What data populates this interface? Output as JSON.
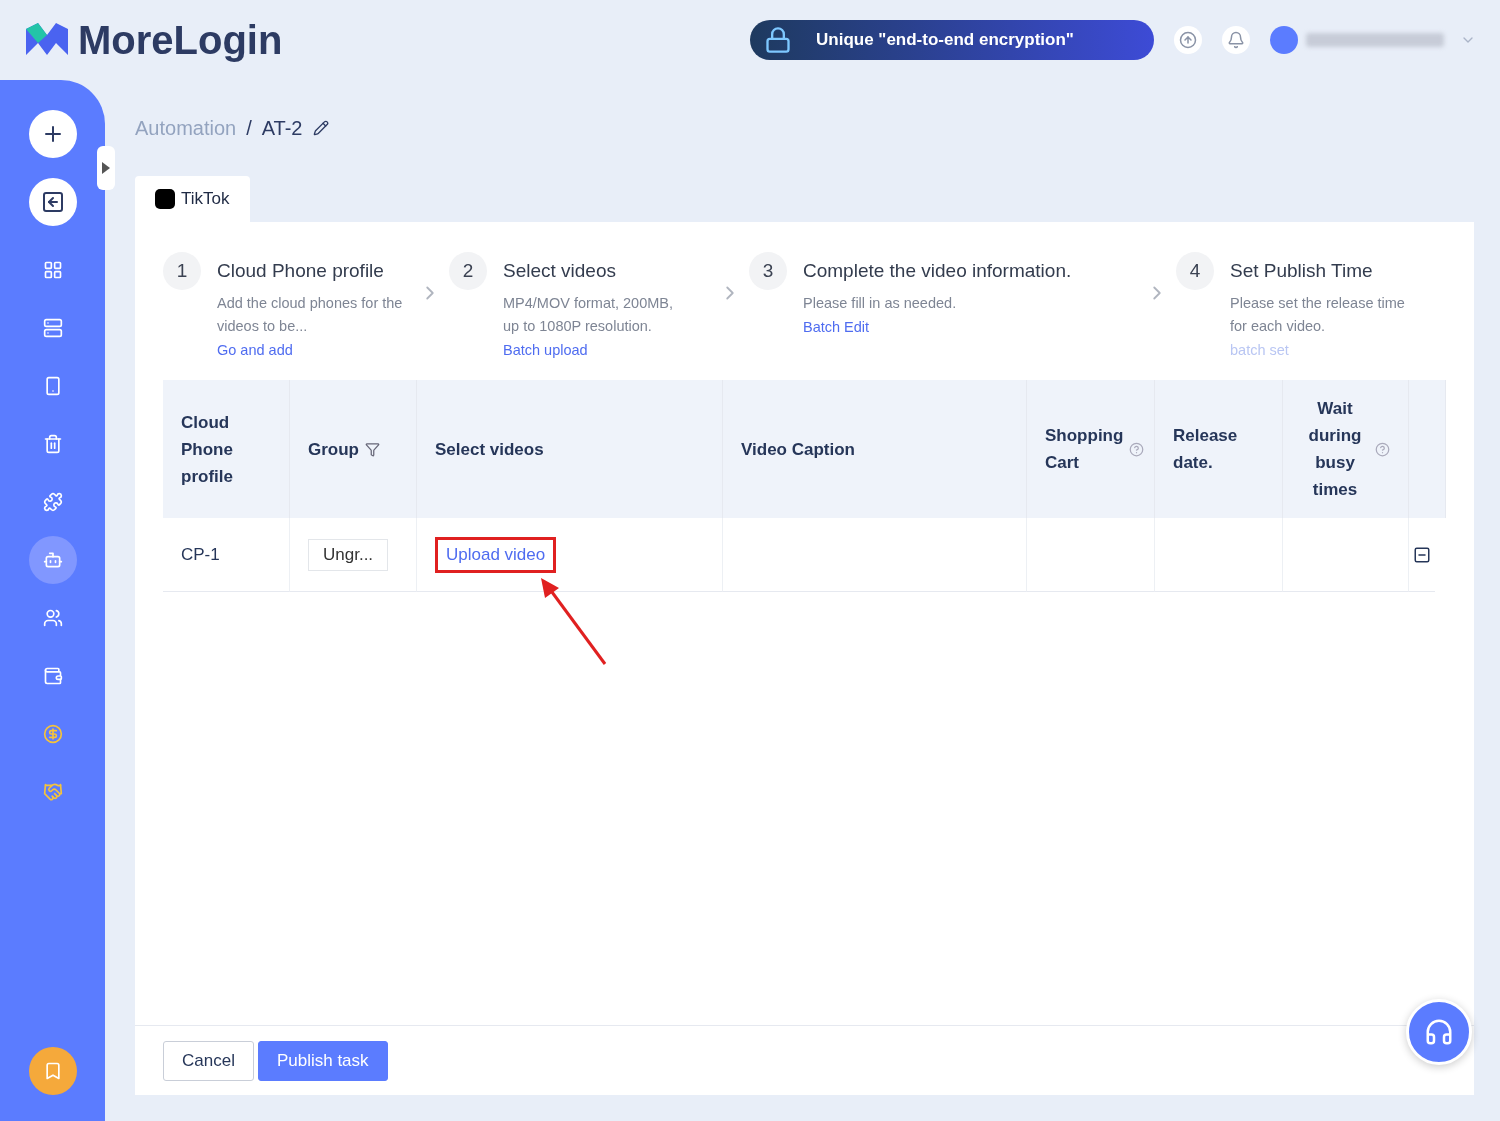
{
  "header": {
    "logo": "MoreLogin",
    "banner": "Unique \"end-to-end encryption\""
  },
  "sidebar": {
    "items": [
      {
        "selected": false
      },
      {
        "selected": false
      },
      {
        "selected": false
      },
      {
        "selected": false
      },
      {
        "selected": false
      },
      {
        "selected": false
      },
      {
        "selected": false
      },
      {
        "selected": true
      },
      {
        "selected": false
      },
      {
        "selected": false
      },
      {
        "selected": false
      },
      {
        "selected": false
      }
    ]
  },
  "breadcrumb": {
    "parent": "Automation",
    "separator": "/",
    "current": "AT-2"
  },
  "tabs": [
    {
      "label": "TikTok",
      "selected": true
    }
  ],
  "steps": [
    {
      "number": "1",
      "title": "Cloud Phone profile",
      "description": "Add the cloud phones for the videos to be...",
      "link": "Go and add",
      "disabled": false
    },
    {
      "number": "2",
      "title": "Select videos",
      "description": "MP4/MOV format, 200MB, up to 1080P resolution.",
      "link": "Batch upload",
      "disabled": false
    },
    {
      "number": "3",
      "title": "Complete the video information.",
      "description": "Please fill in as needed.",
      "link": "Batch Edit",
      "disabled": false
    },
    {
      "number": "4",
      "title": "Set Publish Time",
      "description": "Please set the release time for each video.",
      "link": "batch set",
      "disabled": true
    }
  ],
  "table": {
    "columns": [
      "Cloud Phone profile",
      "Group",
      "Select videos",
      "Video Caption",
      "Shopping Cart",
      "Release date.",
      "Wait during busy times"
    ],
    "rows": [
      {
        "profile": "CP-1",
        "group": "Ungr...",
        "video_action": "Upload video",
        "highlighted": true
      }
    ]
  },
  "footer": {
    "buttons": [
      {
        "label": "Cancel",
        "kind": "secondary"
      },
      {
        "label": "Publish task",
        "kind": "primary"
      }
    ]
  }
}
